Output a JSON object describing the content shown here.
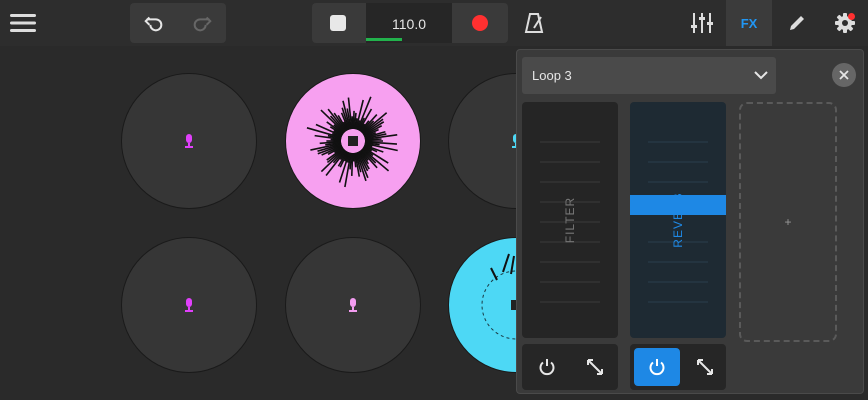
{
  "toolbar": {
    "tempo": "110.0",
    "fx_label": "FX",
    "icons": [
      "menu-icon",
      "undo-icon",
      "redo-icon",
      "stop-icon",
      "record-icon",
      "metronome-icon",
      "mixer-icon",
      "edit-icon",
      "settings-icon"
    ],
    "tempo_progress": 0.42,
    "record_color": "#ff3030",
    "fx_color": "#2196f3"
  },
  "fx_panel": {
    "selected_loop": "Loop 3",
    "filter_label": "FILTER",
    "reverb_label": "REVERB",
    "add_slot_label": "+",
    "reverb_level": 0.57,
    "accent_color": "#1e88e5"
  },
  "pads": {
    "colors": {
      "magenta": "#e040fb",
      "pink": "#f7a0f0",
      "cyan": "#4dd8f5"
    }
  }
}
